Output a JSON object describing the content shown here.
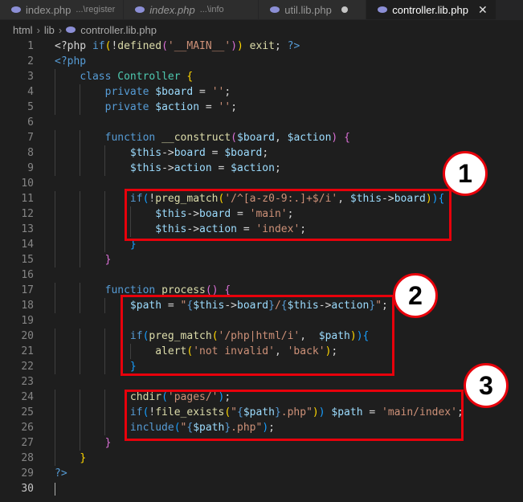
{
  "tabs": [
    {
      "name": "index.php",
      "desc": "...\\register",
      "italic": false,
      "active": false
    },
    {
      "name": "index.php",
      "desc": "...\\info",
      "italic": true,
      "active": false
    },
    {
      "name": "util.lib.php",
      "desc": "",
      "italic": false,
      "active": false,
      "modified": true
    },
    {
      "name": "controller.lib.php",
      "desc": "",
      "italic": false,
      "active": true
    }
  ],
  "breadcrumb": [
    "html",
    "lib",
    "controller.lib.php"
  ],
  "close_glyph": "✕",
  "code_lines": [
    {
      "n": "1"
    },
    {
      "n": "2"
    },
    {
      "n": "3"
    },
    {
      "n": "4"
    },
    {
      "n": "5"
    },
    {
      "n": "6"
    },
    {
      "n": "7"
    },
    {
      "n": "8"
    },
    {
      "n": "9"
    },
    {
      "n": "10"
    },
    {
      "n": "11"
    },
    {
      "n": "12"
    },
    {
      "n": "13"
    },
    {
      "n": "14"
    },
    {
      "n": "15"
    },
    {
      "n": "16"
    },
    {
      "n": "17"
    },
    {
      "n": "18"
    },
    {
      "n": "19"
    },
    {
      "n": "20"
    },
    {
      "n": "21"
    },
    {
      "n": "22"
    },
    {
      "n": "23"
    },
    {
      "n": "24"
    },
    {
      "n": "25"
    },
    {
      "n": "26"
    },
    {
      "n": "27"
    },
    {
      "n": "28"
    },
    {
      "n": "29"
    },
    {
      "n": "30"
    }
  ],
  "code_tokens": [
    [
      [
        "pun",
        "<?php "
      ],
      [
        "kw",
        "if"
      ],
      [
        "br1",
        "("
      ],
      [
        "pun",
        "!"
      ],
      [
        "fn",
        "defined"
      ],
      [
        "br2",
        "("
      ],
      [
        "str",
        "'__MAIN__'"
      ],
      [
        "br2",
        ")"
      ],
      [
        "br1",
        ")"
      ],
      [
        "pun",
        " "
      ],
      [
        "fn",
        "exit"
      ],
      [
        "pun",
        "; "
      ],
      [
        "kw",
        "?>"
      ]
    ],
    [
      [
        "kw",
        "<?php"
      ]
    ],
    [
      [
        "pun",
        "    "
      ],
      [
        "kw",
        "class"
      ],
      [
        "pun",
        " "
      ],
      [
        "cls",
        "Controller"
      ],
      [
        "pun",
        " "
      ],
      [
        "br1",
        "{"
      ]
    ],
    [
      [
        "pun",
        "        "
      ],
      [
        "kw",
        "private"
      ],
      [
        "pun",
        " "
      ],
      [
        "var",
        "$board"
      ],
      [
        "pun",
        " = "
      ],
      [
        "str",
        "''"
      ],
      [
        "pun",
        ";"
      ]
    ],
    [
      [
        "pun",
        "        "
      ],
      [
        "kw",
        "private"
      ],
      [
        "pun",
        " "
      ],
      [
        "var",
        "$action"
      ],
      [
        "pun",
        " = "
      ],
      [
        "str",
        "''"
      ],
      [
        "pun",
        ";"
      ]
    ],
    [],
    [
      [
        "pun",
        "        "
      ],
      [
        "kw",
        "function"
      ],
      [
        "pun",
        " "
      ],
      [
        "fn",
        "__construct"
      ],
      [
        "br2",
        "("
      ],
      [
        "var",
        "$board"
      ],
      [
        "pun",
        ", "
      ],
      [
        "var",
        "$action"
      ],
      [
        "br2",
        ")"
      ],
      [
        "pun",
        " "
      ],
      [
        "br2",
        "{"
      ]
    ],
    [
      [
        "pun",
        "            "
      ],
      [
        "var",
        "$this"
      ],
      [
        "pun",
        "->"
      ],
      [
        "var",
        "board"
      ],
      [
        "pun",
        " = "
      ],
      [
        "var",
        "$board"
      ],
      [
        "pun",
        ";"
      ]
    ],
    [
      [
        "pun",
        "            "
      ],
      [
        "var",
        "$this"
      ],
      [
        "pun",
        "->"
      ],
      [
        "var",
        "action"
      ],
      [
        "pun",
        " = "
      ],
      [
        "var",
        "$action"
      ],
      [
        "pun",
        ";"
      ]
    ],
    [],
    [
      [
        "pun",
        "            "
      ],
      [
        "kw",
        "if"
      ],
      [
        "br3",
        "("
      ],
      [
        "pun",
        "!"
      ],
      [
        "fn",
        "preg_match"
      ],
      [
        "br1",
        "("
      ],
      [
        "str",
        "'/^[a-z0-9:.]+$/i'"
      ],
      [
        "pun",
        ", "
      ],
      [
        "var",
        "$this"
      ],
      [
        "pun",
        "->"
      ],
      [
        "var",
        "board"
      ],
      [
        "br1",
        ")"
      ],
      [
        "br3",
        ")"
      ],
      [
        "br3",
        "{"
      ]
    ],
    [
      [
        "pun",
        "                "
      ],
      [
        "var",
        "$this"
      ],
      [
        "pun",
        "->"
      ],
      [
        "var",
        "board"
      ],
      [
        "pun",
        " = "
      ],
      [
        "str",
        "'main'"
      ],
      [
        "pun",
        ";"
      ]
    ],
    [
      [
        "pun",
        "                "
      ],
      [
        "var",
        "$this"
      ],
      [
        "pun",
        "->"
      ],
      [
        "var",
        "action"
      ],
      [
        "pun",
        " = "
      ],
      [
        "str",
        "'index'"
      ],
      [
        "pun",
        ";"
      ]
    ],
    [
      [
        "pun",
        "            "
      ],
      [
        "br3",
        "}"
      ]
    ],
    [
      [
        "pun",
        "        "
      ],
      [
        "br2",
        "}"
      ]
    ],
    [],
    [
      [
        "pun",
        "        "
      ],
      [
        "kw",
        "function"
      ],
      [
        "pun",
        " "
      ],
      [
        "fn",
        "process"
      ],
      [
        "br2",
        "()"
      ],
      [
        "pun",
        " "
      ],
      [
        "br2",
        "{"
      ]
    ],
    [
      [
        "pun",
        "            "
      ],
      [
        "var",
        "$path"
      ],
      [
        "pun",
        " = "
      ],
      [
        "str",
        "\""
      ],
      [
        "kw",
        "{"
      ],
      [
        "var",
        "$this"
      ],
      [
        "pun",
        "->"
      ],
      [
        "var",
        "board"
      ],
      [
        "kw",
        "}"
      ],
      [
        "str",
        "/"
      ],
      [
        "kw",
        "{"
      ],
      [
        "var",
        "$this"
      ],
      [
        "pun",
        "->"
      ],
      [
        "var",
        "action"
      ],
      [
        "kw",
        "}"
      ],
      [
        "str",
        "\""
      ],
      [
        "pun",
        ";"
      ]
    ],
    [],
    [
      [
        "pun",
        "            "
      ],
      [
        "kw",
        "if"
      ],
      [
        "br3",
        "("
      ],
      [
        "fn",
        "preg_match"
      ],
      [
        "br1",
        "("
      ],
      [
        "str",
        "'/php|html/i'"
      ],
      [
        "pun",
        ",  "
      ],
      [
        "var",
        "$path"
      ],
      [
        "br1",
        ")"
      ],
      [
        "br3",
        ")"
      ],
      [
        "br3",
        "{"
      ]
    ],
    [
      [
        "pun",
        "                "
      ],
      [
        "fn",
        "alert"
      ],
      [
        "br1",
        "("
      ],
      [
        "str",
        "'not invalid'"
      ],
      [
        "pun",
        ", "
      ],
      [
        "str",
        "'back'"
      ],
      [
        "br1",
        ")"
      ],
      [
        "pun",
        ";"
      ]
    ],
    [
      [
        "pun",
        "            "
      ],
      [
        "br3",
        "}"
      ]
    ],
    [],
    [
      [
        "pun",
        "            "
      ],
      [
        "fn",
        "chdir"
      ],
      [
        "br3",
        "("
      ],
      [
        "str",
        "'pages/'"
      ],
      [
        "br3",
        ")"
      ],
      [
        "pun",
        ";"
      ]
    ],
    [
      [
        "pun",
        "            "
      ],
      [
        "kw",
        "if"
      ],
      [
        "br3",
        "("
      ],
      [
        "pun",
        "!"
      ],
      [
        "fn",
        "file_exists"
      ],
      [
        "br1",
        "("
      ],
      [
        "str",
        "\""
      ],
      [
        "kw",
        "{"
      ],
      [
        "var",
        "$path"
      ],
      [
        "kw",
        "}"
      ],
      [
        "str",
        ".php\""
      ],
      [
        "br1",
        ")"
      ],
      [
        "br3",
        ")"
      ],
      [
        "pun",
        " "
      ],
      [
        "var",
        "$path"
      ],
      [
        "pun",
        " = "
      ],
      [
        "str",
        "'main/index'"
      ],
      [
        "pun",
        ";"
      ]
    ],
    [
      [
        "pun",
        "            "
      ],
      [
        "kw",
        "include"
      ],
      [
        "br3",
        "("
      ],
      [
        "str",
        "\""
      ],
      [
        "kw",
        "{"
      ],
      [
        "var",
        "$path"
      ],
      [
        "kw",
        "}"
      ],
      [
        "str",
        ".php\""
      ],
      [
        "br3",
        ")"
      ],
      [
        "pun",
        ";"
      ]
    ],
    [
      [
        "pun",
        "        "
      ],
      [
        "br2",
        "}"
      ]
    ],
    [
      [
        "pun",
        "    "
      ],
      [
        "br1",
        "}"
      ]
    ],
    [
      [
        "kw",
        "?>"
      ]
    ],
    []
  ],
  "annotations": [
    {
      "label": "1"
    },
    {
      "label": "2"
    },
    {
      "label": "3"
    }
  ],
  "colors": {
    "editor_bg": "#1e1e1e",
    "tab_bg": "#2d2d2d",
    "annotation_red": "#e8000b",
    "keyword": "#569cd6",
    "function": "#dcdcaa",
    "variable": "#9cdcfe",
    "string": "#ce9178",
    "class": "#4ec9b0"
  }
}
